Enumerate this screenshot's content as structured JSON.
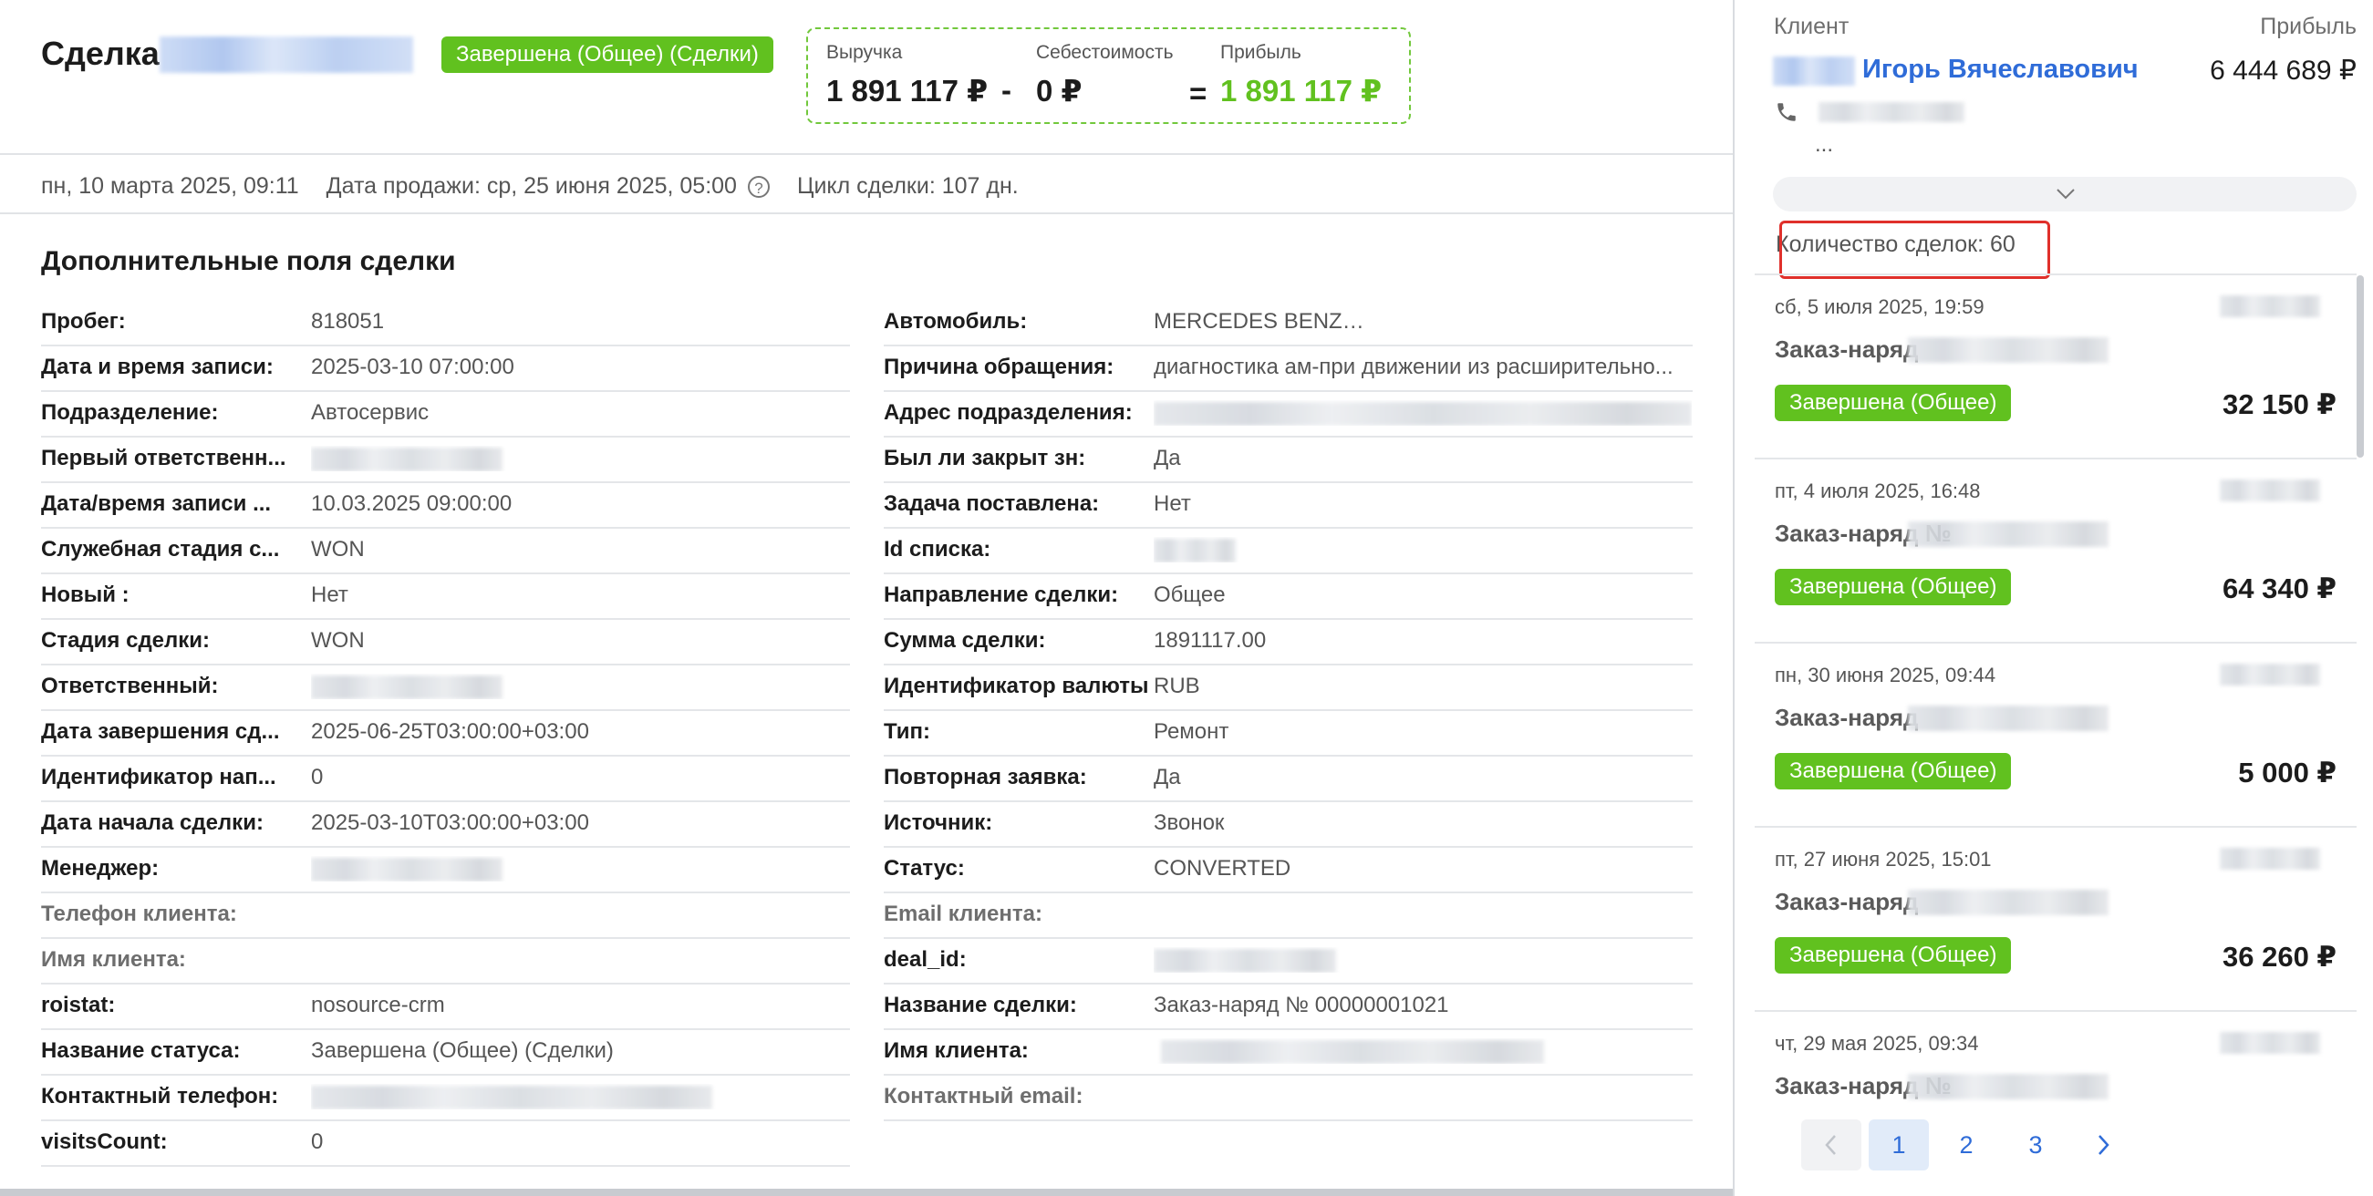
{
  "header": {
    "deal_title": "Сделка",
    "status": "Завершена (Общее) (Сделки)",
    "revenue_label": "Выручка",
    "revenue_value": "1 891 117 ₽",
    "minus": "-",
    "cost_label": "Себестоимость",
    "cost_value": "0 ₽",
    "equals": "=",
    "profit_label": "Прибыль",
    "profit_value": "1 891 117 ₽"
  },
  "meta": {
    "created": "пн, 10 марта 2025, 09:11",
    "sale_date": "Дата продажи: ср, 25 июня 2025, 05:00",
    "help": "?",
    "cycle": "Цикл сделки: 107 дн."
  },
  "extra": {
    "title": "Дополнительные поля сделки",
    "left": [
      {
        "label": "Пробег:",
        "value": "818051"
      },
      {
        "label": "Дата и время записи:",
        "value": "2025-03-10 07:00:00"
      },
      {
        "label": "Подразделение:",
        "value": "Автосервис"
      },
      {
        "label": "Первый ответственн...",
        "value": ""
      },
      {
        "label": "Дата/время записи ...",
        "value": "10.03.2025 09:00:00"
      },
      {
        "label": "Служебная стадия с...",
        "value": "WON"
      },
      {
        "label": "Новый :",
        "value": "Нет"
      },
      {
        "label": "Стадия сделки:",
        "value": "WON"
      },
      {
        "label": "Ответственный:",
        "value": ""
      },
      {
        "label": "Дата завершения сд...",
        "value": "2025-06-25T03:00:00+03:00"
      },
      {
        "label": "Идентификатор нап...",
        "value": "0"
      },
      {
        "label": "Дата начала сделки:",
        "value": "2025-03-10T03:00:00+03:00"
      },
      {
        "label": "Менеджер:",
        "value": ""
      },
      {
        "label": "Телефон клиента:",
        "value": ""
      },
      {
        "label": "Имя клиента:",
        "value": ""
      },
      {
        "label": "roistat:",
        "value": "nosource-crm"
      },
      {
        "label": "Название статуса:",
        "value": "Завершена (Общее) (Сделки)"
      },
      {
        "label": "Контактный телефон:",
        "value": ""
      },
      {
        "label": "visitsCount:",
        "value": "0"
      }
    ],
    "right": [
      {
        "label": "Автомобиль:",
        "value": "MERCEDES BENZ"
      },
      {
        "label": "Причина обращения:",
        "value": "диагностика ам-при движении из расширительно..."
      },
      {
        "label": "Адрес подразделения:",
        "value": ""
      },
      {
        "label": "Был ли закрыт зн:",
        "value": "Да"
      },
      {
        "label": "Задача поставлена:",
        "value": "Нет"
      },
      {
        "label": "Id списка:",
        "value": ""
      },
      {
        "label": "Направление сделки:",
        "value": "Общее"
      },
      {
        "label": "Сумма сделки:",
        "value": "1891117.00"
      },
      {
        "label": "Идентификатор валюты:",
        "value": "RUB"
      },
      {
        "label": "Тип:",
        "value": "Ремонт"
      },
      {
        "label": "Повторная заявка:",
        "value": "Да"
      },
      {
        "label": "Источник:",
        "value": "Звонок"
      },
      {
        "label": "Статус:",
        "value": "CONVERTED"
      },
      {
        "label": "Email клиента:",
        "value": ""
      },
      {
        "label": "deal_id:",
        "value": ""
      },
      {
        "label": "Название сделки:",
        "value": "Заказ-наряд № 00000001021"
      },
      {
        "label": "Имя клиента:",
        "value": ""
      },
      {
        "label": "Контактный email:",
        "value": ""
      }
    ]
  },
  "client": {
    "label": "Клиент",
    "profit_label": "Прибыль",
    "name": "Игорь Вячеславович",
    "profit": "6 444 689 ₽",
    "ellipsis": "...",
    "deals_count": "Количество сделок: 60"
  },
  "deals": [
    {
      "date": "сб, 5 июля 2025, 19:59",
      "title": "Заказ-наряд",
      "status": "Завершена (Общее)",
      "amount": "32 150 ₽"
    },
    {
      "date": "пт, 4 июля 2025, 16:48",
      "title": "Заказ-наряд №",
      "status": "Завершена (Общее)",
      "amount": "64 340 ₽"
    },
    {
      "date": "пн, 30 июня 2025, 09:44",
      "title": "Заказ-наряд",
      "status": "Завершена (Общее)",
      "amount": "5 000 ₽"
    },
    {
      "date": "пт, 27 июня 2025, 15:01",
      "title": "Заказ-наряд",
      "status": "Завершена (Общее)",
      "amount": "36 260 ₽"
    },
    {
      "date": "чт, 29 мая 2025, 09:34",
      "title": "Заказ-наряд №",
      "status": "",
      "amount": ""
    }
  ],
  "pagination": {
    "pages": [
      "1",
      "2",
      "3"
    ],
    "active": "1"
  },
  "colors": {
    "accent_green": "#61c11f",
    "link_blue": "#2f6cd8",
    "highlight_red": "#e0302b"
  }
}
